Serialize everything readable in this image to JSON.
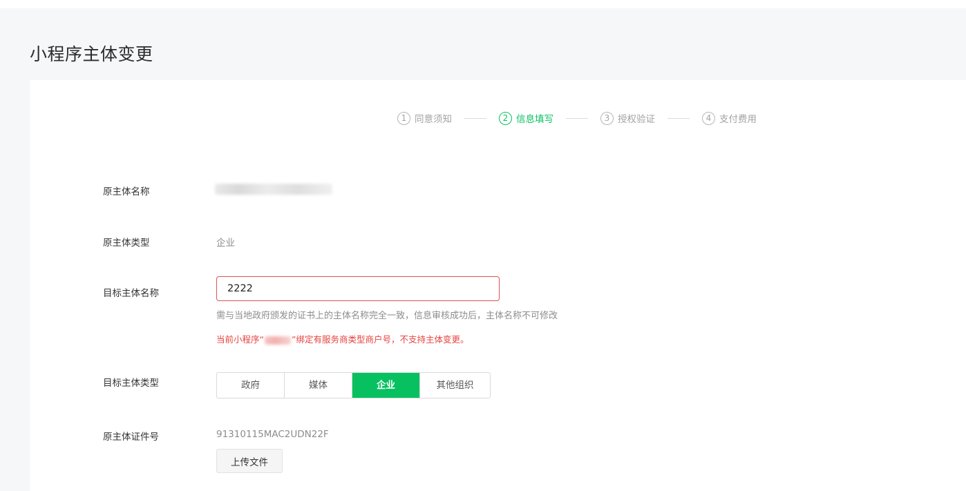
{
  "page": {
    "title": "小程序主体变更"
  },
  "steps": [
    {
      "num": "1",
      "label": "同意须知",
      "active": false
    },
    {
      "num": "2",
      "label": "信息填写",
      "active": true
    },
    {
      "num": "3",
      "label": "授权验证",
      "active": false
    },
    {
      "num": "4",
      "label": "支付费用",
      "active": false
    }
  ],
  "form": {
    "original_name": {
      "label": "原主体名称"
    },
    "original_type": {
      "label": "原主体类型",
      "value": "企业"
    },
    "target_name": {
      "label": "目标主体名称",
      "value": "2222",
      "hint": "需与当地政府颁发的证书上的主体名称完全一致，信息审核成功后，主体名称不可修改",
      "error_prefix": "当前小程序“",
      "error_suffix": "”绑定有服务商类型商户号，不支持主体变更。"
    },
    "target_type": {
      "label": "目标主体类型",
      "options": [
        "政府",
        "媒体",
        "企业",
        "其他组织"
      ],
      "selected": "企业"
    },
    "original_cert": {
      "label": "原主体证件号",
      "value": "91310115MAC2UDN22F",
      "upload_label": "上传文件"
    }
  },
  "colors": {
    "accent": "#07c160",
    "error": "#e64340",
    "input_error_border": "#e15151"
  }
}
